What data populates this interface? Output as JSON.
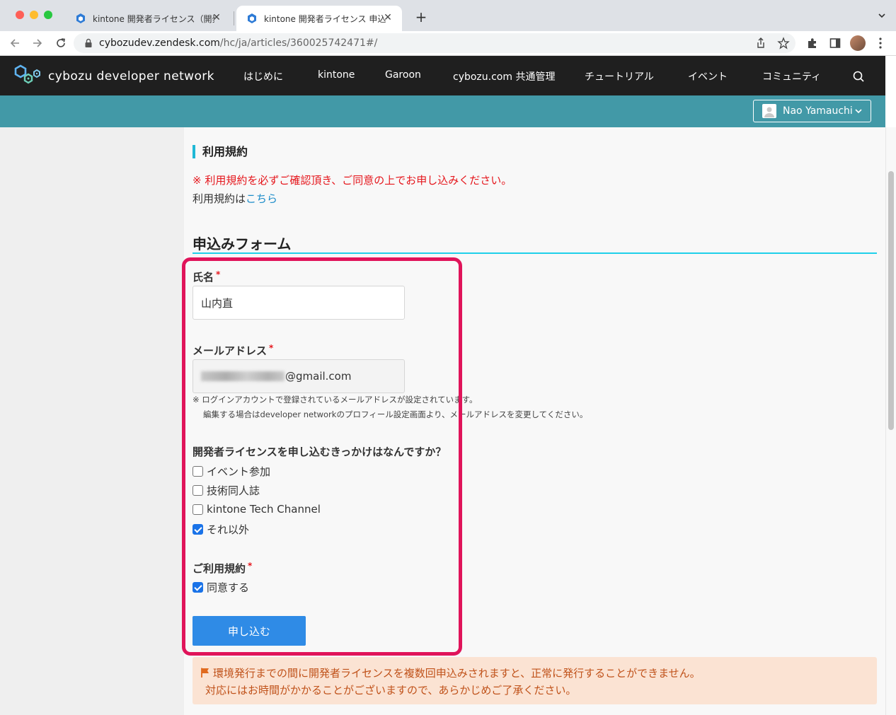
{
  "browser": {
    "tabs": [
      {
        "title": "kintone 開発者ライセンス（開発環",
        "active": false
      },
      {
        "title": "kintone 開発者ライセンス 申込フォ",
        "active": true
      }
    ],
    "url_host": "cybozudev.zendesk.com",
    "url_path": "/hc/ja/articles/360025742471#/"
  },
  "site": {
    "logo_text": "cybozu developer network",
    "nav": [
      "はじめに",
      "kintone",
      "Garoon",
      "cybozu.com 共通管理",
      "チュートリアル",
      "イベント",
      "コミュニティ"
    ],
    "user_name": "Nao Yamauchi"
  },
  "terms": {
    "heading": "利用規約",
    "notice": "※ 利用規約を必ずご確認頂き、ご同意の上でお申し込みください。",
    "text_prefix": "利用規約は",
    "link_text": "こちら"
  },
  "form": {
    "title": "申込みフォーム",
    "name_label": "氏名",
    "name_value": "山内直",
    "email_label": "メールアドレス",
    "email_domain": "@gmail.com",
    "email_note_1": "※ ログインアカウントで登録されているメールアドレスが設定されています。",
    "email_note_2": "編集する場合はdeveloper networkのプロフィール設定画面より、メールアドレスを変更してください。",
    "reason_label": "開発者ライセンスを申し込むきっかけはなんですか？",
    "reasons": [
      {
        "label": "イベント参加",
        "checked": false
      },
      {
        "label": "技術同人誌",
        "checked": false
      },
      {
        "label": "kintone Tech Channel",
        "checked": false
      },
      {
        "label": "それ以外",
        "checked": true
      }
    ],
    "agree_label": "ご利用規約",
    "agree_option": "同意する",
    "agree_checked": true,
    "required_mark": "*",
    "submit_label": "申し込む"
  },
  "warning": {
    "line1": "環境発行までの間に開発者ライセンスを複数回申込みされますと、正常に発行することができません。",
    "line2": "対応にはお時間がかかることがございますので、あらかじめご了承ください。"
  },
  "colors": {
    "header_bg": "#1f1f1f",
    "teal_bar": "#4299a7",
    "accent_cyan": "#1fd0ea",
    "required_red": "#e5161c",
    "highlight": "#e0145a",
    "submit_blue": "#2f8be6",
    "warning_bg": "#fbe3d3",
    "warning_text": "#c0521a"
  },
  "icons": {
    "tab_favicon": "kintone-hex-icon",
    "warning": "flag-icon",
    "search": "search-icon"
  }
}
